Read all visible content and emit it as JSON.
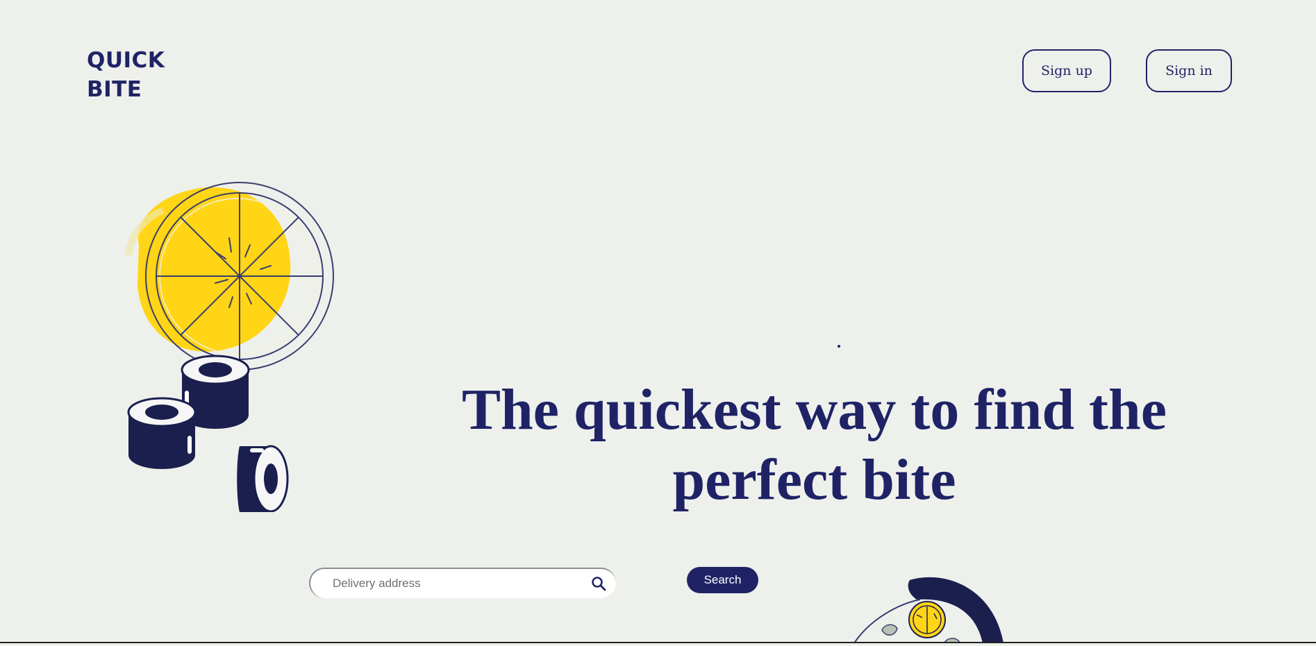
{
  "brand": {
    "line1": "QUICK",
    "line2": "BITE"
  },
  "nav": {
    "signup_label": "Sign up",
    "signin_label": "Sign in"
  },
  "hero": {
    "headline": "The quickest way to find the perfect bite"
  },
  "search": {
    "placeholder": "Delivery address",
    "value": "",
    "button_label": "Search"
  },
  "icons": {
    "search": "search-icon",
    "hero_illustration": "pizza-and-sushi-illustration",
    "bottom_illustration": "food-bowl-illustration"
  },
  "colors": {
    "brand": "#1f2366",
    "accent": "#ffd516",
    "background": "#eef0ec"
  }
}
